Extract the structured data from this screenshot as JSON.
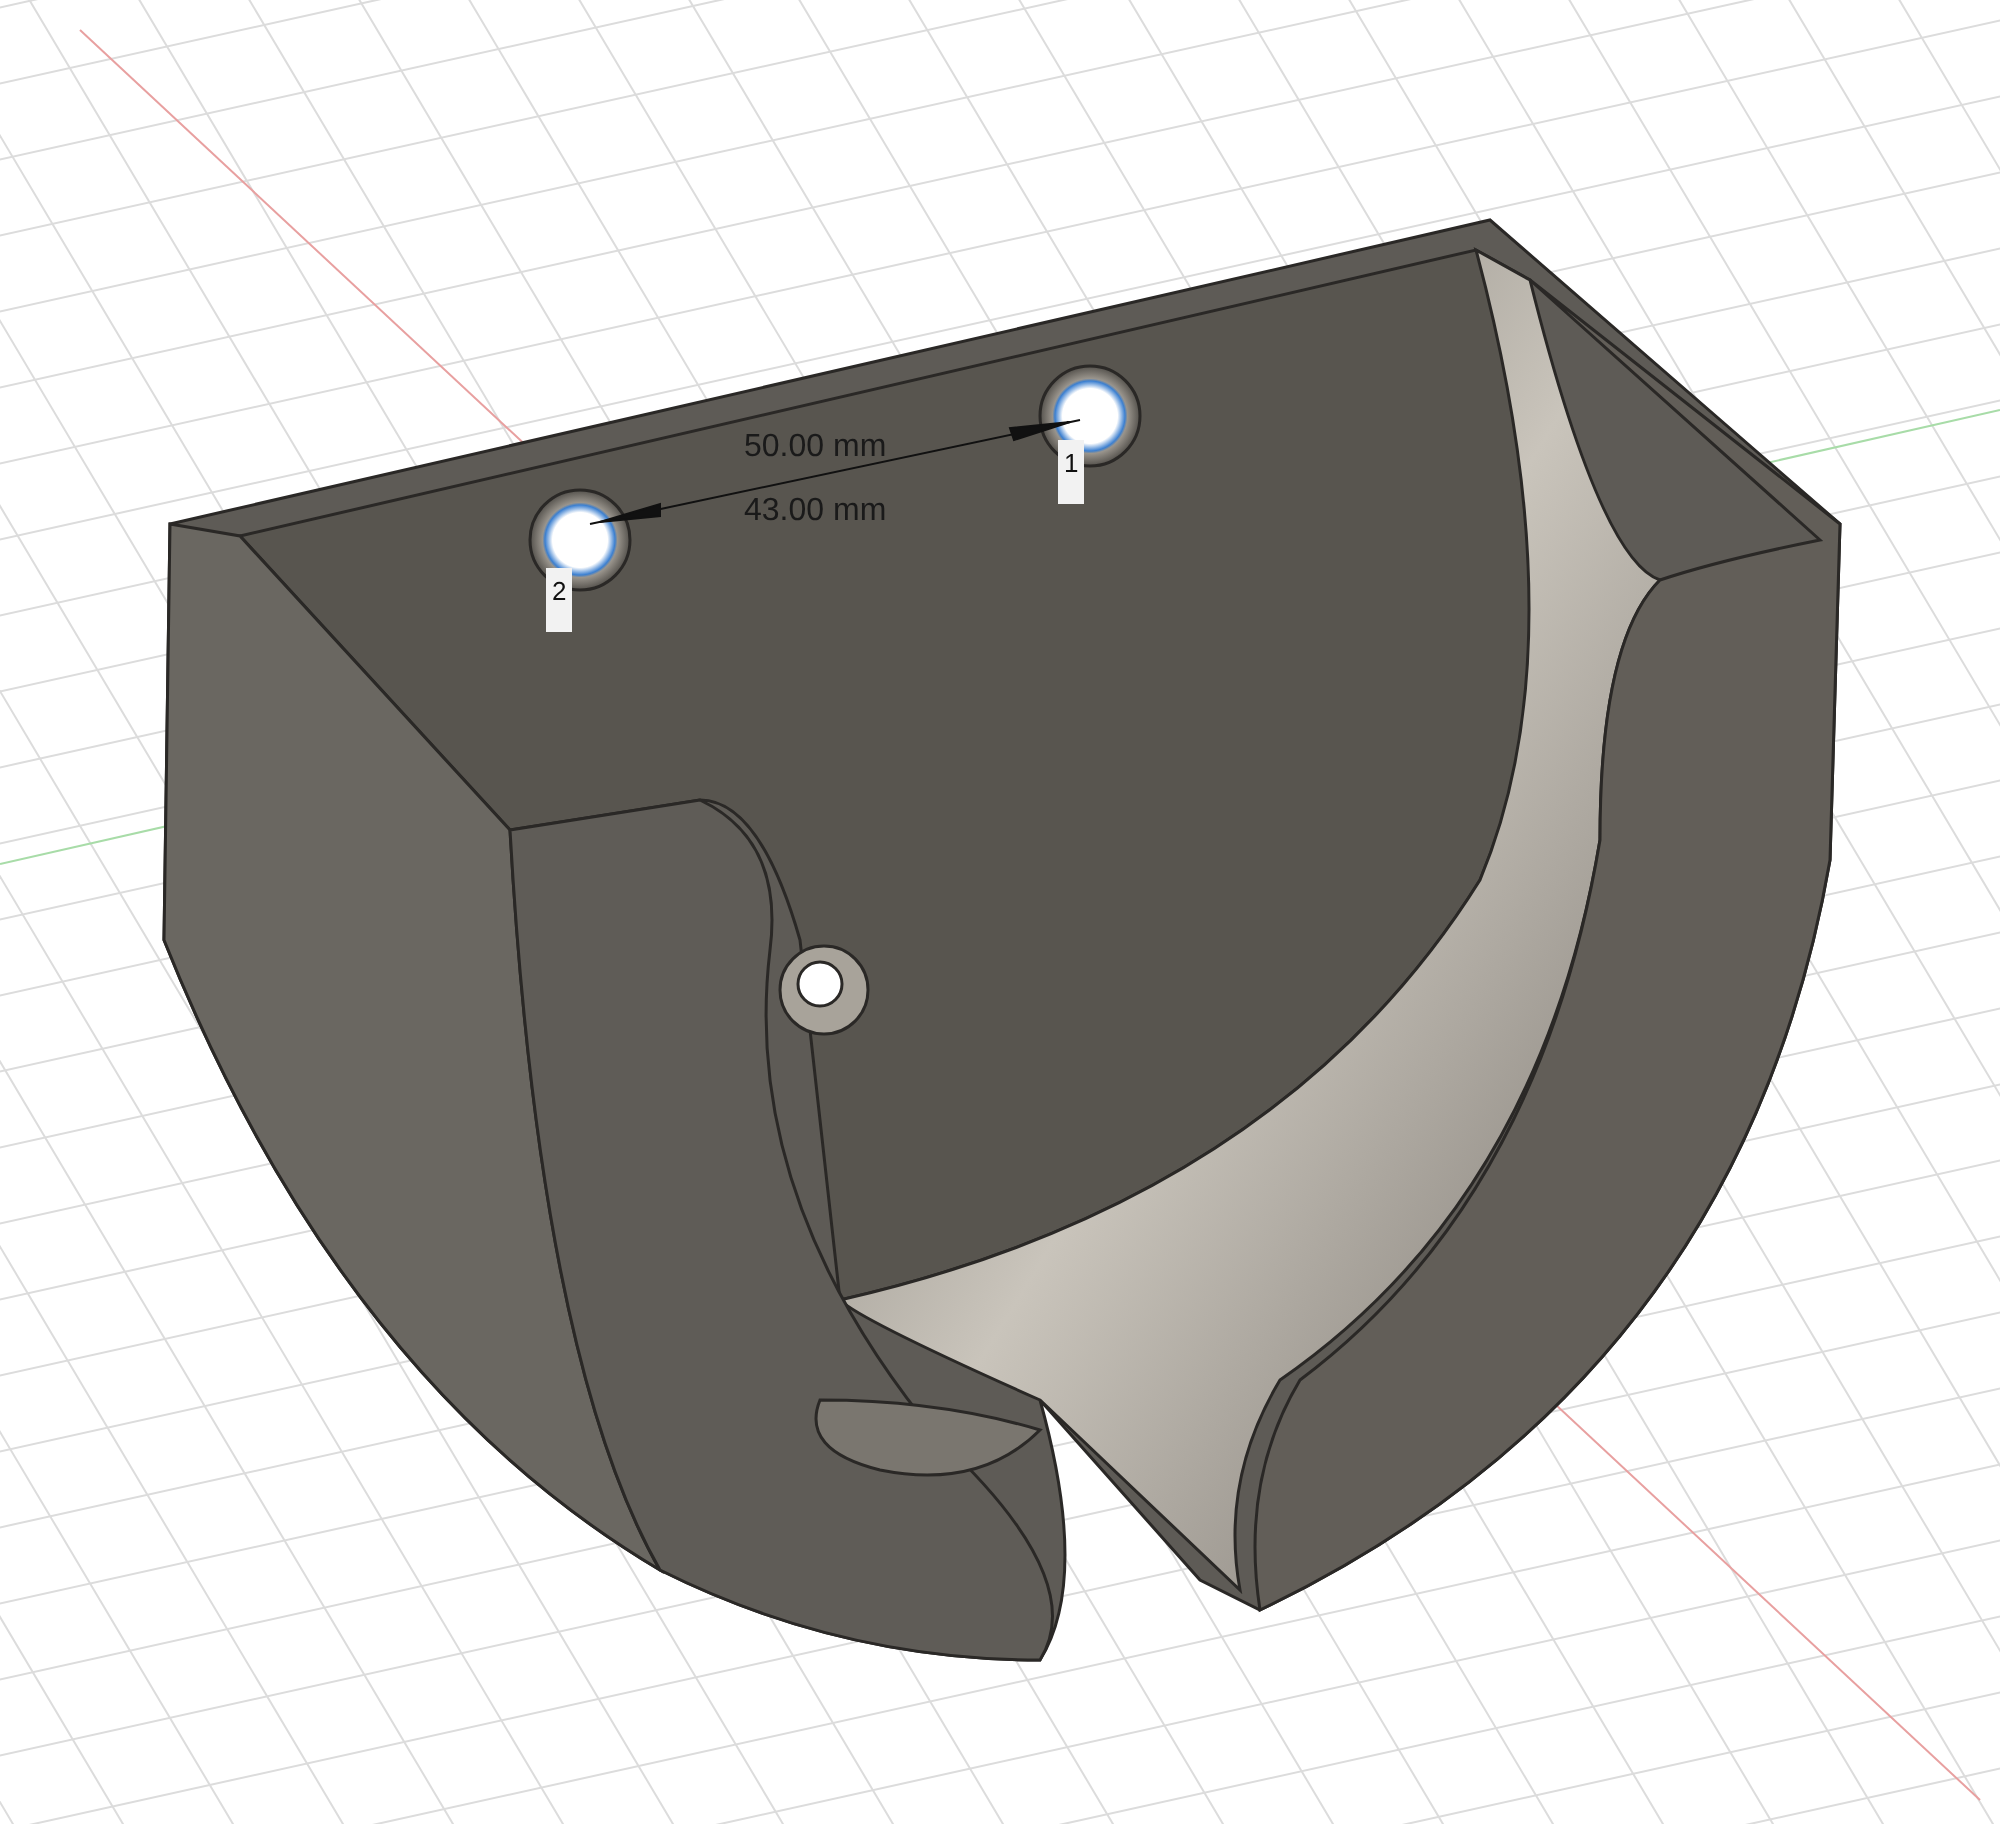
{
  "viewport": {
    "measurements": [
      {
        "text": "50.00 mm"
      },
      {
        "text": "43.00 mm"
      }
    ],
    "hole_markers": [
      {
        "label": "1"
      },
      {
        "label": "2"
      }
    ]
  }
}
